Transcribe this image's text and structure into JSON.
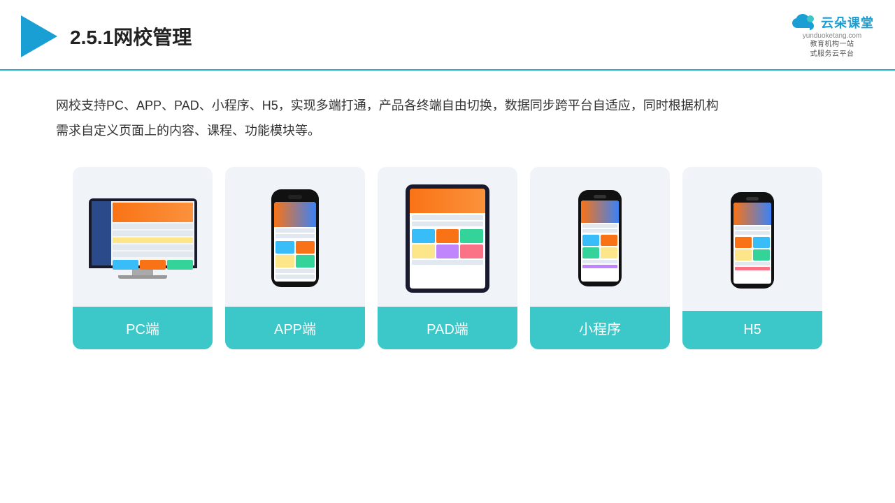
{
  "header": {
    "title": "2.5.1网校管理",
    "brand": {
      "name": "云朵课堂",
      "slogan": "教育机构一站\n式服务云平台",
      "url": "yunduoketang.com"
    }
  },
  "description": {
    "text": "网校支持PC、APP、PAD、小程序、H5，实现多端打通，产品各终端自由切换，数据同步跨平台自适应，同时根据机构需求自定义页面上的内容、课程、功能模块等。"
  },
  "cards": [
    {
      "id": "pc",
      "label": "PC端",
      "device": "pc"
    },
    {
      "id": "app",
      "label": "APP端",
      "device": "phone"
    },
    {
      "id": "pad",
      "label": "PAD端",
      "device": "pad"
    },
    {
      "id": "mini",
      "label": "小程序",
      "device": "mini-phone"
    },
    {
      "id": "h5",
      "label": "H5",
      "device": "mini-phone2"
    }
  ],
  "colors": {
    "accent": "#3cc8c8",
    "header_line": "#1ab3c8",
    "logo": "#1a9fd4",
    "text_dark": "#222222",
    "text_body": "#333333"
  }
}
